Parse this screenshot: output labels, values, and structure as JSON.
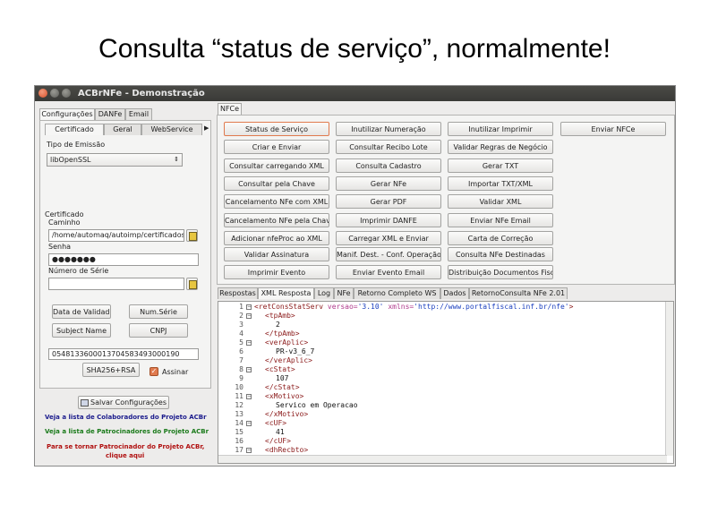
{
  "slide_title": "Consulta “status de serviço”, normalmente!",
  "window": {
    "title": "ACBrNFe - Demonstração"
  },
  "left_tabs": [
    "Configurações",
    "DANFe",
    "Email"
  ],
  "config_tabs": [
    "Certificado",
    "Geral",
    "WebService"
  ],
  "certificado": {
    "tipo_emissao_label": "Tipo de Emissão",
    "tipo_emissao_value": "libOpenSSL",
    "group_label": "Certificado",
    "caminho_label": "Caminho",
    "caminho_value": "/home/automaq/autoimp/certificados/c",
    "senha_label": "Senha",
    "senha_value": "●●●●●●●",
    "numero_serie_label": "Número de Série",
    "numero_serie_value": "",
    "btn_data_validade": "Data de Validade",
    "btn_num_serie": "Num.Série",
    "btn_subject_name": "Subject Name",
    "btn_cnpj": "CNPJ",
    "hash_value": "05481336000137045834930001​90",
    "btn_sha": "SHA256+RSA",
    "assinar_label": "Assinar"
  },
  "salvar_label": "Salvar Configurações",
  "links": {
    "colaboradores": "Veja a lista de Colaboradores do Projeto ACBr",
    "patrocinadores": "Veja a lista de Patrocinadores do Projeto ACBr",
    "tornar_1": "Para se tornar Patrocinador do Projeto ACBr,",
    "tornar_2": "clique aqui"
  },
  "nfce_tab": "NFCe",
  "buttons": [
    [
      "Status de Serviço",
      "Inutilizar Numeração",
      "Inutilizar Imprimir",
      "Enviar NFCe"
    ],
    [
      "Criar e Enviar",
      "Consultar Recibo Lote",
      "Validar Regras de Negócio"
    ],
    [
      "Consultar carregando XML",
      "Consulta Cadastro",
      "Gerar TXT"
    ],
    [
      "Consultar pela Chave",
      "Gerar NFe",
      "Importar TXT/XML"
    ],
    [
      "Cancelamento NFe com XML",
      "Gerar PDF",
      "Validar XML"
    ],
    [
      "Cancelamento NFe pela Chave",
      "Imprimir DANFE",
      "Enviar NFe Email"
    ],
    [
      "Adicionar nfeProc ao XML",
      "Carregar XML e Enviar",
      "Carta de Correção"
    ],
    [
      "Validar Assinatura",
      "Manif. Dest. - Conf. Operação",
      "Consulta NFe Destinadas"
    ],
    [
      "Imprimir Evento",
      "Enviar Evento Email",
      "Distribuição Documentos Fiscai"
    ]
  ],
  "bottom_tabs": [
    "Respostas",
    "XML Resposta",
    "Log",
    "NFe",
    "Retorno Completo WS",
    "Dados",
    "RetornoConsulta NFe 2.01"
  ],
  "xml_line_numbers": [
    "1",
    "2",
    "3",
    "4",
    "5",
    "6",
    "7",
    "8",
    "9",
    "10",
    "11",
    "12",
    "13",
    "14",
    "15",
    "16",
    "17"
  ],
  "xml": {
    "l1_tag": "<retConsStatServ",
    "l1_attr1": " versao=",
    "l1_val1": "'3.10'",
    "l1_attr2": " xmlns=",
    "l1_val2": "'http://www.portalfiscal.inf.br/nfe'",
    "l1_close": ">",
    "l2": "<tpAmb>",
    "l3": "2",
    "l4": "</tpAmb>",
    "l5": "<verAplic>",
    "l6": "PR-v3_6_7",
    "l7": "</verAplic>",
    "l8": "<cStat>",
    "l9": "107",
    "l10": "</cStat>",
    "l11": "<xMotivo>",
    "l12": "Servico em Operacao",
    "l13": "</xMotivo>",
    "l14": "<cUF>",
    "l15": "41",
    "l16": "</cUF>",
    "l17": "<dhRecbto>"
  }
}
